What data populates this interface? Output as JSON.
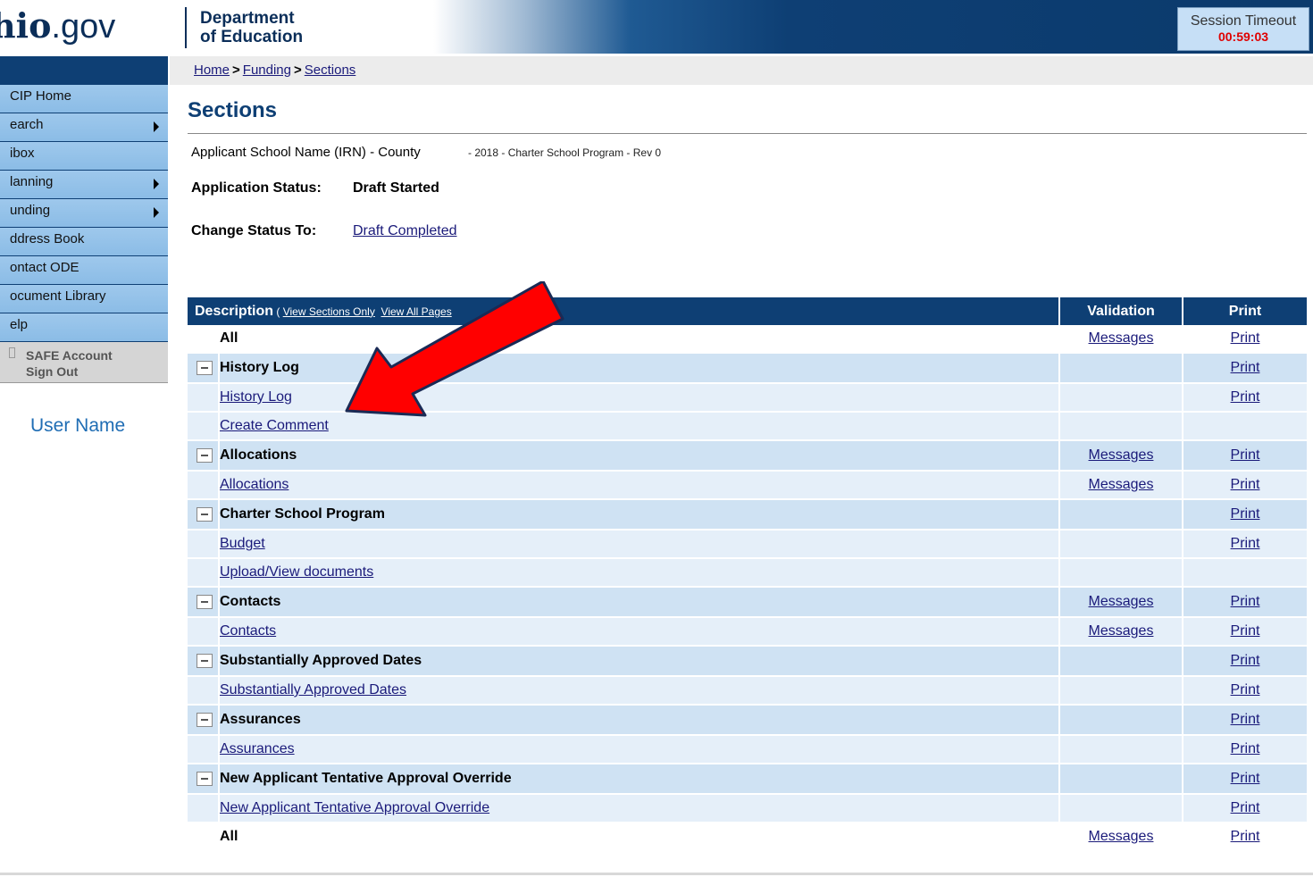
{
  "header": {
    "logo_main": "hio",
    "logo_suffix": ".gov",
    "dept_line1": "Department",
    "dept_line2": "of Education",
    "session_label": "Session Timeout",
    "session_time": "00:59:03"
  },
  "breadcrumb": {
    "home": "Home",
    "sep": ">",
    "funding": "Funding",
    "sections": "Sections"
  },
  "sidebar": {
    "items": [
      {
        "label": "CIP Home",
        "arrow": false
      },
      {
        "label": "earch",
        "arrow": true
      },
      {
        "label": "ibox",
        "arrow": false
      },
      {
        "label": "lanning",
        "arrow": true
      },
      {
        "label": "unding",
        "arrow": true
      },
      {
        "label": "ddress Book",
        "arrow": false
      },
      {
        "label": "ontact ODE",
        "arrow": false
      },
      {
        "label": "ocument Library",
        "arrow": false
      },
      {
        "label": "elp",
        "arrow": false
      }
    ],
    "safe_line1": "SAFE Account",
    "safe_line2": "Sign Out",
    "user_name": "User Name"
  },
  "main": {
    "title": "Sections",
    "applicant": "Applicant School Name (IRN) - County",
    "applicant_rev": "- 2018 - Charter School Program - Rev 0",
    "status_label": "Application Status:",
    "status_value": "Draft Started",
    "change_label": "Change Status To:",
    "change_value": "Draft Completed"
  },
  "table": {
    "col_description": "Description",
    "view_open": " ( ",
    "view_sections_only": "View Sections Only",
    "view_all_pages": "View All Pages",
    "col_validation": "Validation",
    "col_print": "Print",
    "rows": [
      {
        "type": "all",
        "name": "All",
        "validation": "Messages",
        "print": "Print"
      },
      {
        "type": "sec",
        "name": "History Log",
        "validation": "",
        "print": "Print"
      },
      {
        "type": "item",
        "name": "History Log",
        "validation": "",
        "print": "Print"
      },
      {
        "type": "item",
        "name": "Create Comment",
        "validation": "",
        "print": ""
      },
      {
        "type": "sec",
        "name": "Allocations",
        "validation": "Messages",
        "print": "Print"
      },
      {
        "type": "item",
        "name": "Allocations",
        "validation": "Messages",
        "print": "Print"
      },
      {
        "type": "sec",
        "name": "Charter School Program",
        "validation": "",
        "print": "Print"
      },
      {
        "type": "item",
        "name": "Budget",
        "validation": "",
        "print": "Print"
      },
      {
        "type": "item",
        "name": "Upload/View documents",
        "validation": "",
        "print": ""
      },
      {
        "type": "sec",
        "name": "Contacts",
        "validation": "Messages",
        "print": "Print"
      },
      {
        "type": "item",
        "name": "Contacts",
        "validation": "Messages",
        "print": "Print"
      },
      {
        "type": "sec",
        "name": "Substantially Approved Dates",
        "validation": "",
        "print": "Print"
      },
      {
        "type": "item",
        "name": "Substantially Approved Dates",
        "validation": "",
        "print": "Print"
      },
      {
        "type": "sec",
        "name": "Assurances",
        "validation": "",
        "print": "Print"
      },
      {
        "type": "item",
        "name": "Assurances",
        "validation": "",
        "print": "Print"
      },
      {
        "type": "sec",
        "name": "New Applicant Tentative Approval Override",
        "validation": "",
        "print": "Print"
      },
      {
        "type": "item",
        "name": "New Applicant Tentative Approval Override",
        "validation": "",
        "print": "Print"
      },
      {
        "type": "all",
        "name": "All",
        "validation": "Messages",
        "print": "Print"
      }
    ]
  },
  "colors": {
    "navy": "#0e3f74",
    "nav_blue": "#8bbce6",
    "section_row": "#cfe2f3",
    "item_row": "#e5eff9",
    "arrow_red": "#ff0000"
  }
}
